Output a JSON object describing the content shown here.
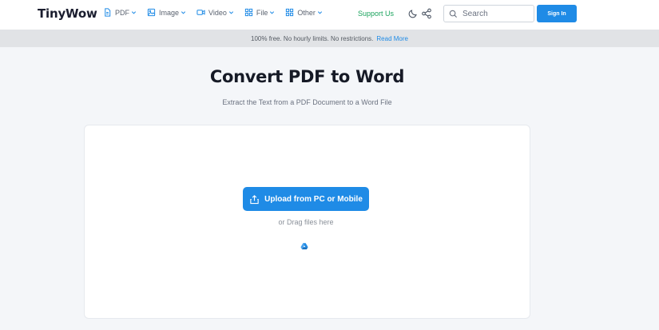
{
  "header": {
    "logo": "TinyWow",
    "nav": [
      {
        "label": "PDF",
        "icon": "document-icon"
      },
      {
        "label": "Image",
        "icon": "image-icon"
      },
      {
        "label": "Video",
        "icon": "video-icon"
      },
      {
        "label": "File",
        "icon": "grid-icon"
      },
      {
        "label": "Other",
        "icon": "grid-icon"
      }
    ],
    "support_label": "Support Us",
    "search_placeholder": "Search",
    "signin_label": "Sign In"
  },
  "banner": {
    "text": "100% free. No hourly limits. No restrictions.",
    "link": "Read More"
  },
  "main": {
    "title": "Convert PDF to Word",
    "subtitle": "Extract the Text from a PDF Document to a Word File",
    "upload_label": "Upload from PC or Mobile",
    "drag_text": "or Drag files here"
  },
  "colors": {
    "accent": "#1f8be6",
    "support": "#1aa35d",
    "banner_bg": "#e1e3e6",
    "page_bg": "#f4f6f9"
  }
}
